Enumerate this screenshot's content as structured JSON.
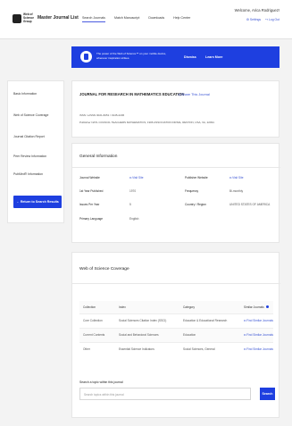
{
  "header": {
    "logo_text": "Web of Science Group",
    "brand": "Master Journal List",
    "nav": [
      "Search Journals",
      "Match Manuscript",
      "Downloads",
      "Help Center"
    ],
    "welcome": "Welcome, Arica Rodriguez!",
    "settings": "Settings",
    "logout": "Log Out"
  },
  "banner": {
    "message": "The power of the Web of Science™ on your mobile device, wherever inspiration strikes.",
    "dismiss": "Dismiss",
    "learn_more": "Learn More"
  },
  "sidebar": {
    "items": [
      "Basic Information",
      "Web of Science Coverage",
      "Journal Citation Report",
      "Peer Review Information",
      "PubMed® Information"
    ],
    "return_button": "← Return to Search Results"
  },
  "journal": {
    "title": "JOURNAL FOR RESEARCH IN MATHEMATICS EDUCATION",
    "share": "Share This Journal",
    "issn": "ISSN / eISSN 0021-8251 / 1945-2236",
    "publisher": "Publisher NATL COUNCIL TEACHERS MATHEMATICS, 1906 ASSOCIATION DRIVE, RESTON, USA, VA, 22091"
  },
  "general": {
    "title": "General Information",
    "left": [
      {
        "label": "Journal Website",
        "value": "Visit Site",
        "link": true
      },
      {
        "label": "1st Year Published",
        "value": "1970",
        "link": false
      },
      {
        "label": "Issues Per Year",
        "value": "5",
        "link": false
      },
      {
        "label": "Primary Language",
        "value": "English",
        "link": false
      }
    ],
    "right": [
      {
        "label": "Publisher Website",
        "value": "Visit Site",
        "link": true
      },
      {
        "label": "Frequency",
        "value": "Bi-monthly",
        "link": false
      },
      {
        "label": "Country / Region",
        "value": "UNITED STATES OF AMERICA",
        "link": false
      }
    ]
  },
  "coverage": {
    "title": "Web of Science Coverage",
    "columns": [
      "Collection",
      "Index",
      "Category",
      "Similar Journals"
    ],
    "rows": [
      [
        "Core Collection",
        "Social Sciences Citation Index (SSCI)",
        "Education & Educational Research",
        "Find Similar Journals"
      ],
      [
        "Current Contents",
        "Social and Behavioral Sciences",
        "Education",
        "Find Similar Journals"
      ],
      [
        "Other",
        "Essential Science Indicators",
        "Social Sciences, General",
        "Find Similar Journals"
      ]
    ],
    "search_label": "Search a topic within this journal",
    "search_placeholder": "Search topics within this journal",
    "search_button": "Search"
  }
}
